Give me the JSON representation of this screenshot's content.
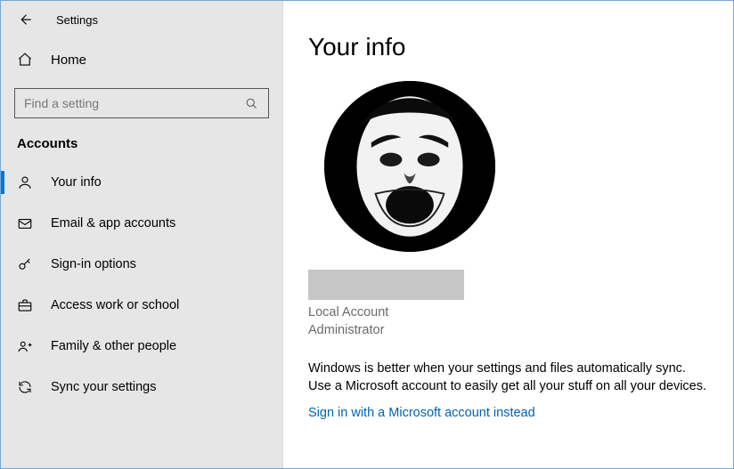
{
  "titlebar": {
    "title": "Settings"
  },
  "sidebar": {
    "home": "Home",
    "search_placeholder": "Find a setting",
    "section": "Accounts",
    "items": [
      {
        "label": "Your info"
      },
      {
        "label": "Email & app accounts"
      },
      {
        "label": "Sign-in options"
      },
      {
        "label": "Access work or school"
      },
      {
        "label": "Family & other people"
      },
      {
        "label": "Sync your settings"
      }
    ]
  },
  "main": {
    "heading": "Your info",
    "account_type": "Local Account",
    "account_role": "Administrator",
    "promo": "Windows is better when your settings and files automatically sync. Use a Microsoft account to easily get all your stuff on all your devices.",
    "signin_link": "Sign in with a Microsoft account instead"
  }
}
